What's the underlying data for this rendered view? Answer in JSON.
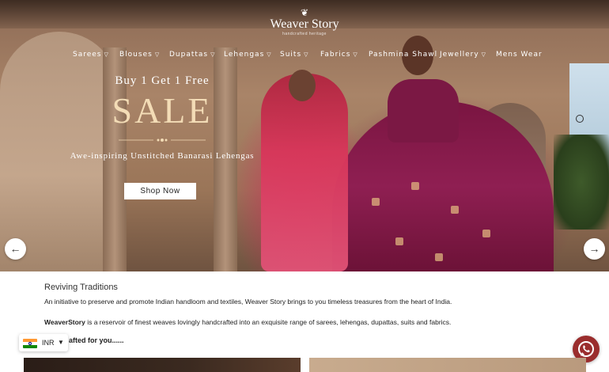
{
  "brand": {
    "name": "Weaver Story",
    "tagline": "handcrafted heritage"
  },
  "nav": [
    {
      "label": "Sarees",
      "has_dropdown": true
    },
    {
      "label": "Blouses",
      "has_dropdown": true
    },
    {
      "label": "Dupattas",
      "has_dropdown": true
    },
    {
      "label": "Lehengas",
      "has_dropdown": true
    },
    {
      "label": "Suits",
      "has_dropdown": true
    },
    {
      "label": "Fabrics",
      "has_dropdown": true
    },
    {
      "label": "Pashmina Shawl",
      "has_dropdown": false
    },
    {
      "label": "Jewellery",
      "has_dropdown": true
    },
    {
      "label": "Mens Wear",
      "has_dropdown": false
    }
  ],
  "hero": {
    "offer": "Buy 1 Get 1 Free",
    "headline": "SALE",
    "subtitle": "Awe-inspiring Unstitched Banarasi Lehengas",
    "cta": "Shop Now",
    "prev_icon": "arrow-left-icon",
    "next_icon": "arrow-right-icon"
  },
  "intro": {
    "title": "Reviving Traditions",
    "line1": "An initiative to preserve and promote Indian handloom and textiles, Weaver Story brings to you timeless treasures from the heart of India.",
    "line2_brand": "WeaverStory",
    "line2_rest": " is a reservoir of finest weaves lovingly handcrafted into an exquisite range of sarees, lehengas, dupattas, suits and fabrics.",
    "line3": "afted for you......"
  },
  "currency": {
    "code": "INR",
    "flag_icon": "india-flag-icon",
    "caret_icon": "caret-down-icon"
  },
  "whatsapp": {
    "icon": "whatsapp-icon",
    "color": "#9a2d2d"
  },
  "colors": {
    "sale_gold": "#f3dcb6",
    "nav_text": "#ffffff"
  }
}
